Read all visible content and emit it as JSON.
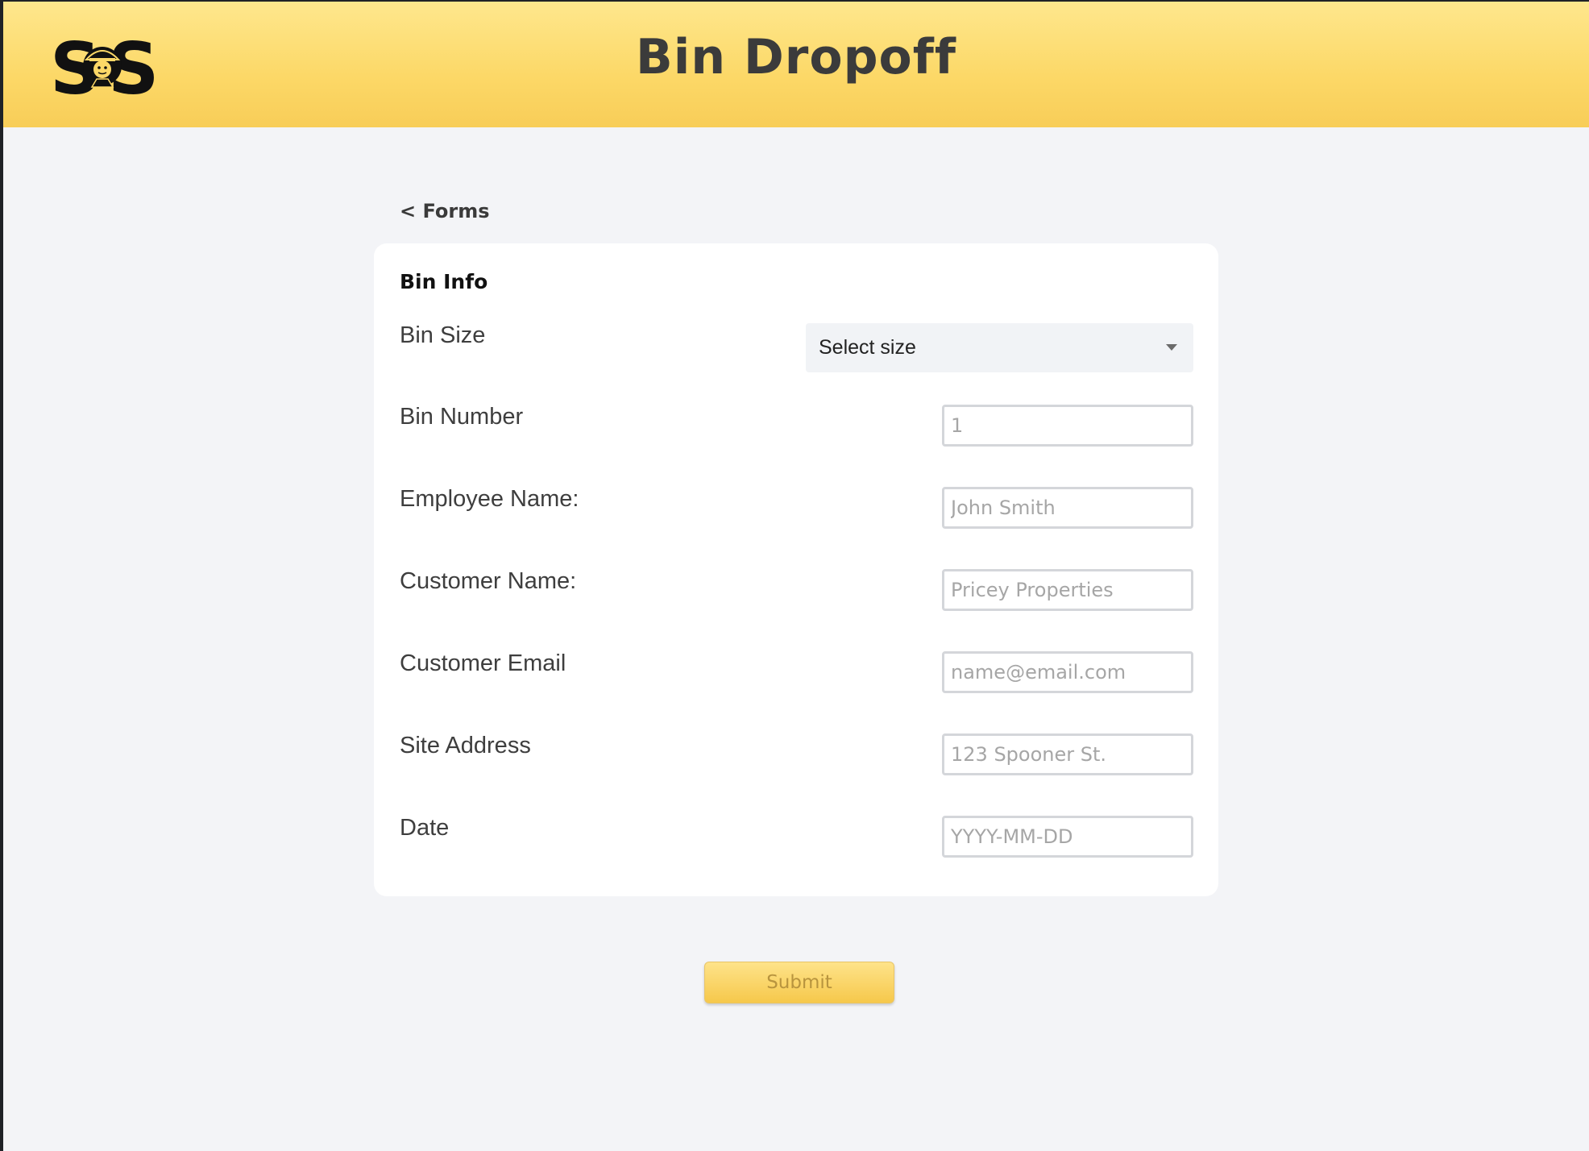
{
  "header": {
    "logo_text": "SOS",
    "title": "Bin Dropoff"
  },
  "nav": {
    "back_label": "< Forms"
  },
  "form": {
    "section_title": "Bin Info",
    "bin_size": {
      "label": "Bin Size",
      "selected": "Select size"
    },
    "bin_number": {
      "label": "Bin Number",
      "placeholder": "1"
    },
    "employee_name": {
      "label": "Employee Name:",
      "placeholder": "John Smith"
    },
    "customer_name": {
      "label": "Customer Name:",
      "placeholder": "Pricey Properties"
    },
    "customer_email": {
      "label": "Customer Email",
      "placeholder": "name@email.com"
    },
    "site_address": {
      "label": "Site Address",
      "placeholder": "123 Spooner St."
    },
    "date": {
      "label": "Date",
      "placeholder": "YYYY-MM-DD"
    }
  },
  "actions": {
    "submit_label": "Submit"
  },
  "colors": {
    "header_yellow": "#fcd867",
    "page_background": "#f3f4f7",
    "card_background": "#ffffff",
    "submit_text": "#b8943e"
  }
}
